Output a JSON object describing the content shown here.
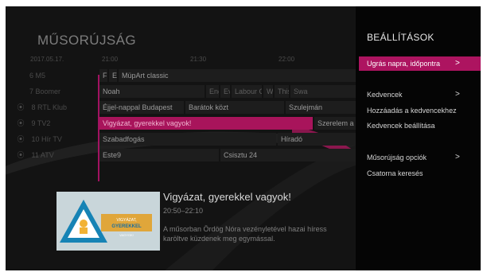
{
  "guide": {
    "title": "MŰSORÚJSÁG",
    "date": "2017.05.17.",
    "times": [
      "21:00",
      "21:30",
      "22:00"
    ],
    "channels": [
      {
        "number": "6",
        "name": "M5",
        "recording": false
      },
      {
        "number": "7",
        "name": "Boomer",
        "recording": false
      },
      {
        "number": "8",
        "name": "RTL Klub",
        "recording": true
      },
      {
        "number": "9",
        "name": "TV2",
        "recording": true
      },
      {
        "number": "10",
        "name": "Hír TV",
        "recording": true
      },
      {
        "number": "11",
        "name": "ATV",
        "recording": true
      }
    ],
    "rows": [
      [
        "Fi",
        "El",
        "MüpArt classic"
      ],
      [
        "Noah",
        "Engl",
        "Ev",
        "Labour C",
        "W",
        "This",
        "Swa"
      ],
      [
        "Éjjel-nappal Budapest",
        "Barátok közt",
        "Szulejmán"
      ],
      [
        "Vigyázat, gyerekkel vagyok!",
        "Szerelem a"
      ],
      [
        "Szabadfogás",
        "Híradó"
      ],
      [
        "Este9",
        "Csisztu 24"
      ]
    ]
  },
  "info": {
    "title": "Vigyázat, gyerekkel vagyok!",
    "time": "20:50–22:10",
    "desc_line1": "A műsorban Ördög Nóra vezényletével hazai híress",
    "desc_line2": "karöltve küzdenek meg egymással.",
    "thumb_text": "VIGYÁZAT, GYEREKKEL VAGYOK!"
  },
  "panel": {
    "title": "BEÁLLÍTÁSOK",
    "items": [
      {
        "label": "Ugrás napra, időpontra",
        "chevron": ">",
        "selected": true
      },
      {
        "label": "Kedvencek",
        "chevron": ">"
      },
      {
        "label": "Hozzáadás a kedvencekhez"
      },
      {
        "label": "Kedvencek beállítása"
      },
      {
        "label": "Műsorújság opciók",
        "chevron": ">"
      },
      {
        "label": "Csatorna keresés"
      }
    ]
  },
  "colors": {
    "accent": "#ad1460",
    "background": "#131313",
    "panel": "#050505"
  },
  "icons": {
    "recording": "record-icon",
    "chevron": "chevron-right-icon"
  }
}
